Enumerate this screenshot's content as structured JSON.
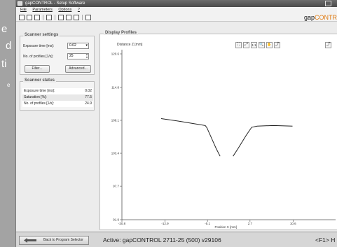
{
  "side_text": {
    "l1": "e",
    "l2": "d",
    "l3": "ti",
    "l4": "e"
  },
  "window": {
    "title": "gapCONTROL - Setup Software"
  },
  "menu": [
    "File",
    "Parameters",
    "Options",
    "?"
  ],
  "brand": {
    "part1": "gap",
    "part2": "CONTR"
  },
  "scanner_settings": {
    "title": "Scanner settings",
    "exposure_label": "Exposure time [ms]:",
    "exposure_value": "0.02",
    "profiles_label": "No. of profiles [1/s]:",
    "profiles_value": "25",
    "filter_button": "Filter...",
    "advanced_button": "Advanced..."
  },
  "scanner_status": {
    "title": "Scanner status",
    "rows": [
      {
        "label": "Exposure time [ms]:",
        "value": "0.02"
      },
      {
        "label": "Saturation [%]:",
        "value": "77.5"
      },
      {
        "label": "No. of profiles [1/s]:",
        "value": "24.9"
      }
    ]
  },
  "display_profiles": {
    "title": "Display Profiles"
  },
  "plot_tools": [
    "⛶",
    "⤢",
    "1:1",
    "🔍",
    "✋",
    "⤴"
  ],
  "chart_data": {
    "type": "line",
    "ylabel": "Distance Z [mm]",
    "xlabel": "Position X [mm]",
    "x_ticks": [
      "-20.8",
      "-12.9",
      "-5.1",
      "2.7",
      "10.6"
    ],
    "y_ticks": [
      "120.6",
      "114.8",
      "109.1",
      "103.4",
      "97.7",
      "91.9"
    ],
    "xlim": [
      -20.8,
      18.4
    ],
    "ylim": [
      91.9,
      120.6
    ],
    "series": [
      {
        "values": [
          [
            -13.6,
            109.4
          ],
          [
            -10.0,
            108.9
          ],
          [
            -6.8,
            108.4
          ],
          [
            -5.5,
            108.2
          ],
          [
            -5.2,
            107.8
          ],
          [
            -3.5,
            104.2
          ],
          [
            -2.8,
            102.9
          ]
        ]
      },
      {
        "values": [
          [
            -0.4,
            102.9
          ],
          [
            0.5,
            104.2
          ],
          [
            2.0,
            106.5
          ],
          [
            3.0,
            107.9
          ],
          [
            4.0,
            108.1
          ],
          [
            7.0,
            108.2
          ],
          [
            10.5,
            108.1
          ]
        ]
      }
    ]
  },
  "status": {
    "back_button": "Back to Program Selector",
    "active_text": "Active: gapCONTROL  2711-25 (500)  v29106",
    "fkey_text": "<F1> H"
  }
}
